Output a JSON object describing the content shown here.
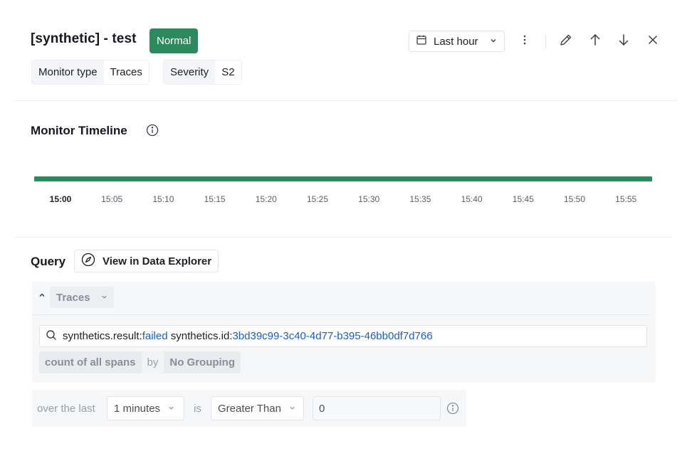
{
  "header": {
    "title": "[synthetic] - test",
    "status": "Normal",
    "tags": [
      {
        "key": "Monitor type",
        "value": "Traces"
      },
      {
        "key": "Severity",
        "value": "S2"
      }
    ],
    "time_range": "Last hour",
    "icons": [
      "calendar-icon",
      "more-vertical-icon",
      "edit-icon",
      "arrow-up-icon",
      "arrow-down-icon",
      "close-icon"
    ]
  },
  "timeline": {
    "title": "Monitor Timeline",
    "state": "Normal",
    "ticks": [
      "15:00",
      "15:05",
      "15:10",
      "15:15",
      "15:20",
      "15:25",
      "15:30",
      "15:35",
      "15:40",
      "15:45",
      "15:50",
      "15:55"
    ]
  },
  "query": {
    "title": "Query",
    "explorer_label": "View in Data Explorer",
    "source": "Traces",
    "search": {
      "part1_key": "synthetics.result:",
      "part1_val": "failed",
      "part2_key": "synthetics.id:",
      "part2_val": "3bd39c99-3c40-4d77-b395-46bb0df7d766"
    },
    "aggregation": "count of all spans",
    "by_label": "by",
    "grouping": "No Grouping"
  },
  "condition": {
    "over_label": "over the last",
    "window": "1 minutes",
    "is_label": "is",
    "operator": "Greater Than",
    "threshold": "0"
  },
  "colors": {
    "status_green": "#2d8a5f",
    "link_blue": "#1b5cc4"
  }
}
